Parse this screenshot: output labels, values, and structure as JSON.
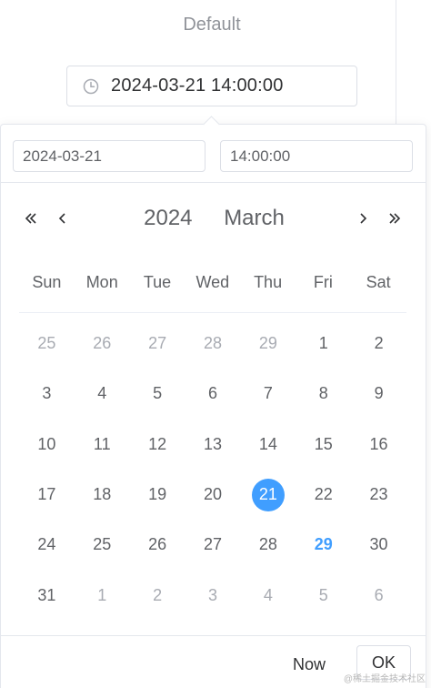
{
  "label": "Default",
  "trigger": {
    "icon": "clock-icon",
    "value": "2024-03-21 14:00:00"
  },
  "picker": {
    "date_input": "2024-03-21",
    "time_input": "14:00:00",
    "nav": {
      "prev_year": "«",
      "prev_month": "‹",
      "year": "2024",
      "month": "March",
      "next_month": "›",
      "next_year": "»"
    },
    "weekdays": [
      "Sun",
      "Mon",
      "Tue",
      "Wed",
      "Thu",
      "Fri",
      "Sat"
    ],
    "days": [
      {
        "d": "25",
        "t": "other"
      },
      {
        "d": "26",
        "t": "other"
      },
      {
        "d": "27",
        "t": "other"
      },
      {
        "d": "28",
        "t": "other"
      },
      {
        "d": "29",
        "t": "other"
      },
      {
        "d": "1",
        "t": "cur"
      },
      {
        "d": "2",
        "t": "cur"
      },
      {
        "d": "3",
        "t": "cur"
      },
      {
        "d": "4",
        "t": "cur"
      },
      {
        "d": "5",
        "t": "cur"
      },
      {
        "d": "6",
        "t": "cur"
      },
      {
        "d": "7",
        "t": "cur"
      },
      {
        "d": "8",
        "t": "cur"
      },
      {
        "d": "9",
        "t": "cur"
      },
      {
        "d": "10",
        "t": "cur"
      },
      {
        "d": "11",
        "t": "cur"
      },
      {
        "d": "12",
        "t": "cur"
      },
      {
        "d": "13",
        "t": "cur"
      },
      {
        "d": "14",
        "t": "cur"
      },
      {
        "d": "15",
        "t": "cur"
      },
      {
        "d": "16",
        "t": "cur"
      },
      {
        "d": "17",
        "t": "cur"
      },
      {
        "d": "18",
        "t": "cur"
      },
      {
        "d": "19",
        "t": "cur"
      },
      {
        "d": "20",
        "t": "cur"
      },
      {
        "d": "21",
        "t": "selected"
      },
      {
        "d": "22",
        "t": "cur"
      },
      {
        "d": "23",
        "t": "cur"
      },
      {
        "d": "24",
        "t": "cur"
      },
      {
        "d": "25",
        "t": "cur"
      },
      {
        "d": "26",
        "t": "cur"
      },
      {
        "d": "27",
        "t": "cur"
      },
      {
        "d": "28",
        "t": "cur"
      },
      {
        "d": "29",
        "t": "today"
      },
      {
        "d": "30",
        "t": "cur"
      },
      {
        "d": "31",
        "t": "cur"
      },
      {
        "d": "1",
        "t": "other"
      },
      {
        "d": "2",
        "t": "other"
      },
      {
        "d": "3",
        "t": "other"
      },
      {
        "d": "4",
        "t": "other"
      },
      {
        "d": "5",
        "t": "other"
      },
      {
        "d": "6",
        "t": "other"
      }
    ],
    "footer": {
      "now_label": "Now",
      "ok_label": "OK"
    }
  },
  "watermark": "@稀土掘金技术社区",
  "colors": {
    "accent": "#409eff",
    "muted": "#a8abb2",
    "text": "#606266"
  }
}
